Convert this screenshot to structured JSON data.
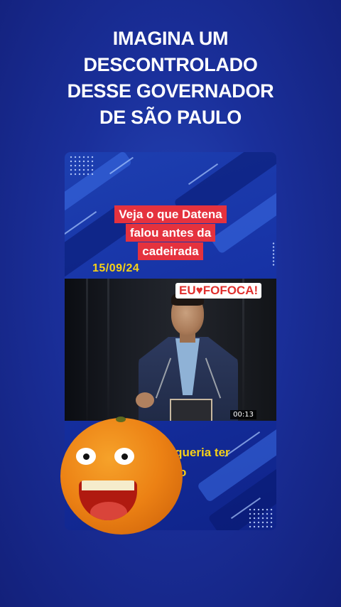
{
  "headline": {
    "lines": [
      "IMAGINA UM",
      "DESCONTROLADO",
      "DESSE GOVERNADOR",
      "DE SÃO PAULO"
    ]
  },
  "card": {
    "caption_lines": [
      "Veja o que Datena",
      "falou antes da",
      "cadeirada"
    ],
    "date": "15/09/24",
    "badge": {
      "left": "EU",
      "heart": "♥",
      "right": "FOFOCA!"
    },
    "video_time": "00:13",
    "subtitle_line1": "ê queria ter",
    "subtitle_line2": "o"
  },
  "colors": {
    "background": "#1a2f9a",
    "caption_bg": "#e5323e",
    "accent_yellow": "#f7d117",
    "badge_red": "#e0302e"
  },
  "icons": {
    "mascot": "orange-mascot-icon"
  }
}
